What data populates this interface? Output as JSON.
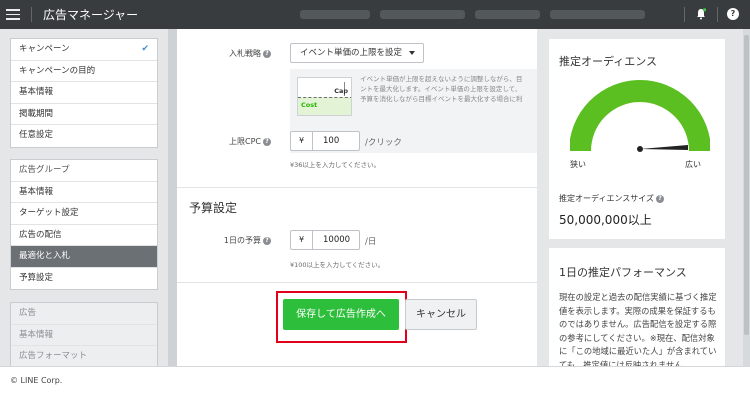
{
  "header": {
    "title": "広告マネージャー",
    "help_label": "?"
  },
  "sidebar": {
    "campaign_items": [
      {
        "label": "キャンペーン"
      },
      {
        "label": "キャンペーンの目的"
      },
      {
        "label": "基本情報"
      },
      {
        "label": "掲載期間"
      },
      {
        "label": "任意設定"
      }
    ],
    "adgroup_items": [
      {
        "label": "広告グループ"
      },
      {
        "label": "基本情報"
      },
      {
        "label": "ターゲット設定"
      },
      {
        "label": "広告の配信"
      },
      {
        "label": "最適化と入札"
      },
      {
        "label": "予算設定"
      }
    ],
    "ad_items": [
      {
        "label": "広告"
      },
      {
        "label": "基本情報"
      },
      {
        "label": "広告フォーマット"
      }
    ]
  },
  "main": {
    "bid_strategy_label": "入札戦略",
    "bid_strategy_value": "イベント単価の上限を設定",
    "graph_cost": "Cost",
    "graph_cap": "Cap",
    "graph_desc_lines": [
      "イベント単価が上限を超えないように調整しながら、目",
      "ントを最大化します。イベント単価の上限を設定して、",
      "予算を消化しながら目標イベントを最大化する場合に利"
    ],
    "cpc_label": "上限CPC",
    "currency": "¥",
    "cpc_value": "100",
    "cpc_unit": "/クリック",
    "cpc_hint": "¥36以上を入力してください。",
    "budget_section_title": "予算設定",
    "daily_budget_label": "1日の予算",
    "daily_budget_value": "10000",
    "daily_budget_unit": "/日",
    "daily_budget_hint": "¥100以上を入力してください。",
    "save_button": "保存して広告作成へ",
    "cancel_button": "キャンセル"
  },
  "right": {
    "audience_title": "推定オーディエンス",
    "gauge_narrow": "狭い",
    "gauge_wide": "広い",
    "audience_size_label": "推定オーディエンスサイズ",
    "audience_size_value": "50,000,000以上",
    "performance_title": "1日の推定パフォーマンス",
    "performance_desc": "現在の設定と過去の配信実績に基づく推定値を表示します。実際の成果を保証するものではありません。広告配信を設定する際の参考にしてください。※現在、配信対象に「この地域に最近いた人」が含まれていても、推定値には反映されません。"
  },
  "footer": {
    "copyright": "© LINE Corp."
  },
  "colors": {
    "topbar": "#383c3f",
    "save_green": "#2dbe3b",
    "gauge_green": "#5bbf21",
    "highlight_red": "#e2001a",
    "active_nav": "#6b7075"
  }
}
